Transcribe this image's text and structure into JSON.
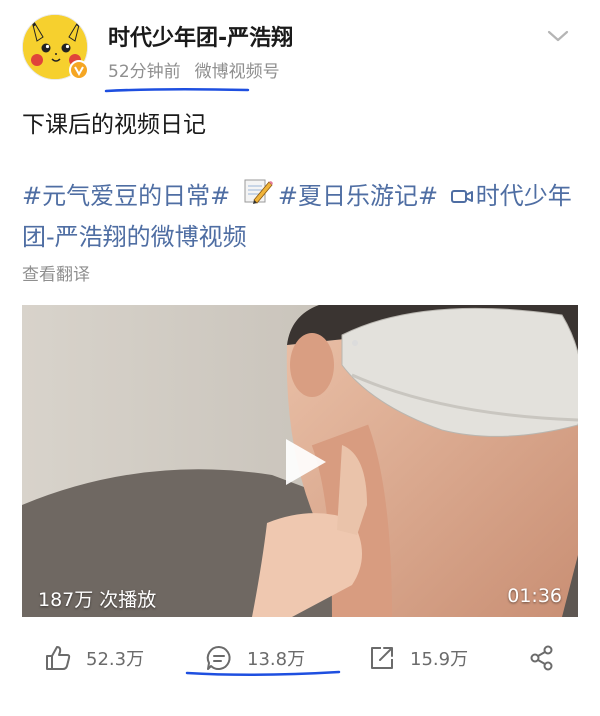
{
  "post": {
    "author": "时代少年团-严浩翔",
    "time_ago": "52分钟前",
    "source": "微博视频号",
    "title": "下课后的视频日记",
    "topic_1": "#元气爱豆的日常#",
    "topic_2": "#夏日乐游记#",
    "video_link": "时代少年团-严浩翔的微博视频",
    "translate": "查看翻译"
  },
  "video": {
    "views": "187万 次播放",
    "duration": "01:36"
  },
  "actions": {
    "likes": "52.3万",
    "comments": "13.8万",
    "reposts": "15.9万"
  },
  "colors": {
    "link": "#4f6ea3",
    "annotation": "#1e4fe0",
    "verified": "#f5a623"
  }
}
